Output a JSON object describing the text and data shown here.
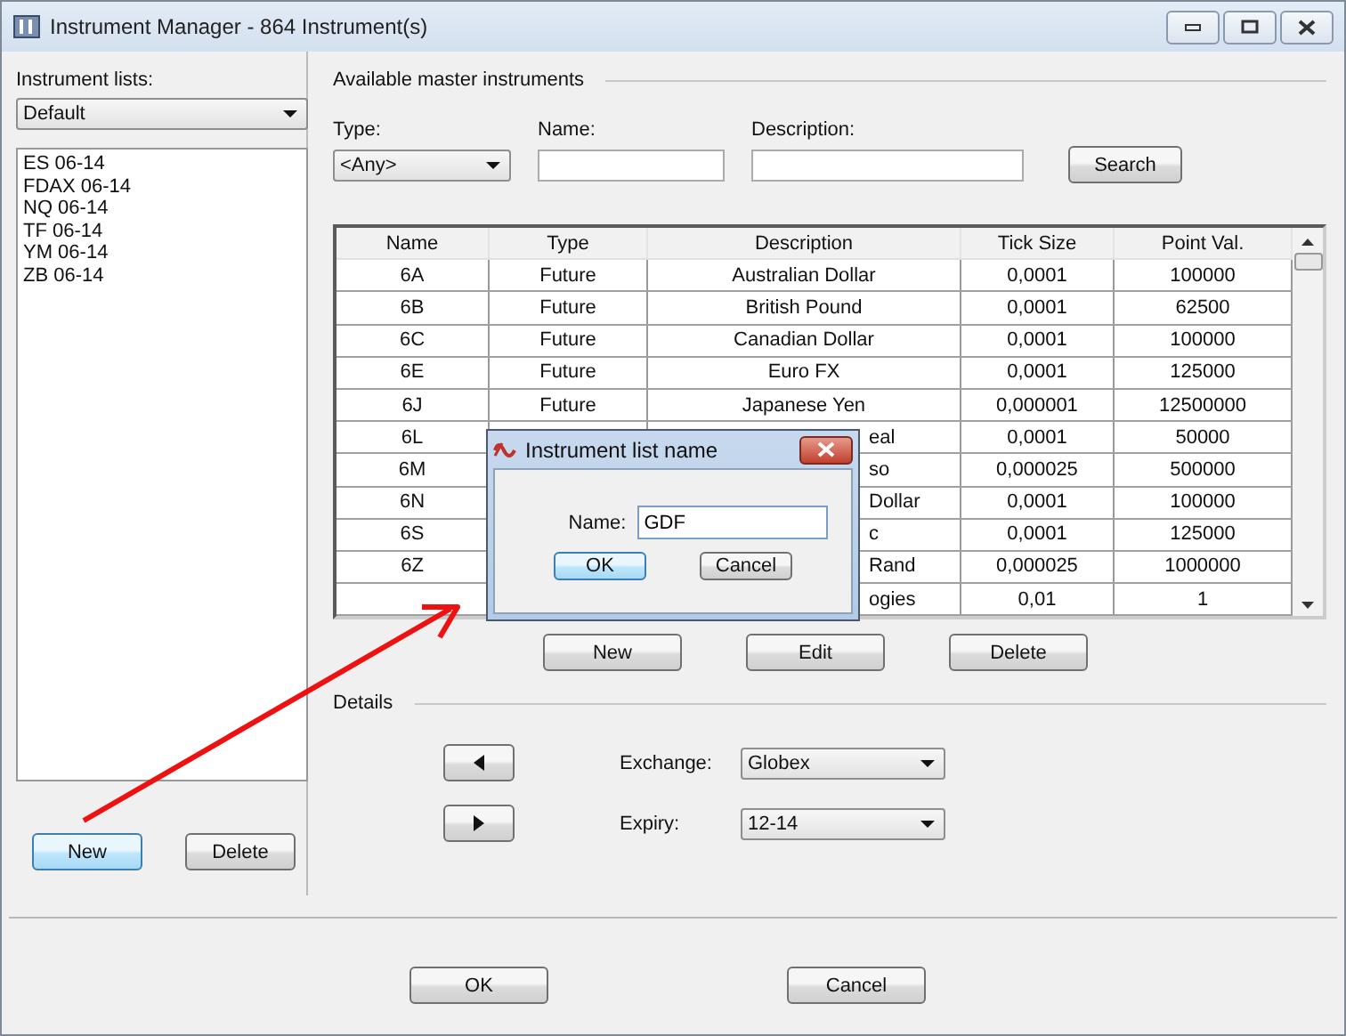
{
  "window": {
    "title": "Instrument Manager - 864 Instrument(s)"
  },
  "instrument_lists": {
    "label": "Instrument lists:",
    "dropdown": "Default",
    "items": [
      "ES 06-14",
      "FDAX 06-14",
      "NQ 06-14",
      "TF 06-14",
      "YM 06-14",
      "ZB 06-14"
    ],
    "buttons": [
      {
        "label": "New",
        "focused": true
      },
      {
        "label": "Delete",
        "focused": false
      }
    ]
  },
  "master": {
    "title": "Available master instruments",
    "type_label": "Type:",
    "type_value": "<Any>",
    "name_label": "Name:",
    "description_label": "Description:",
    "search_button": "Search"
  },
  "table": {
    "columns": [
      "Name",
      "Type",
      "Description",
      "Tick Size",
      "Point Val."
    ],
    "rows": [
      {
        "name": "6A",
        "type": "Future",
        "description": "Australian Dollar",
        "tick_size": "0,0001",
        "point_value": "100000",
        "covered": false
      },
      {
        "name": "6B",
        "type": "Future",
        "description": "British Pound",
        "tick_size": "0,0001",
        "point_value": "62500",
        "covered": false
      },
      {
        "name": "6C",
        "type": "Future",
        "description": "Canadian Dollar",
        "tick_size": "0,0001",
        "point_value": "100000",
        "covered": false
      },
      {
        "name": "6E",
        "type": "Future",
        "description": "Euro FX",
        "tick_size": "0,0001",
        "point_value": "125000",
        "covered": false
      },
      {
        "name": "6J",
        "type": "Future",
        "description": "Japanese Yen",
        "tick_size": "0,000001",
        "point_value": "12500000",
        "covered": false
      },
      {
        "name": "6L",
        "description": "eal",
        "tick_size": "0,0001",
        "point_value": "50000",
        "covered": true
      },
      {
        "name": "6M",
        "description": "so",
        "tick_size": "0,000025",
        "point_value": "500000",
        "covered": true
      },
      {
        "name": "6N",
        "description": "Dollar",
        "tick_size": "0,0001",
        "point_value": "100000",
        "covered": true
      },
      {
        "name": "6S",
        "description": "c",
        "tick_size": "0,0001",
        "point_value": "125000",
        "covered": true
      },
      {
        "name": "6Z",
        "description": "Rand",
        "tick_size": "0,000025",
        "point_value": "1000000",
        "covered": true
      },
      {
        "description": "ogies",
        "tick_size": "0,01",
        "point_value": "1",
        "covered": true
      }
    ],
    "buttons": [
      "New",
      "Edit",
      "Delete"
    ]
  },
  "details": {
    "title": "Details",
    "exchange_label": "Exchange:",
    "exchange_value": "Globex",
    "expiry_label": "Expiry:",
    "expiry_value": "12-14"
  },
  "footer_buttons": [
    "OK",
    "Cancel"
  ],
  "dialog": {
    "title": "Instrument list name",
    "name_label": "Name:",
    "name_value": "GDF",
    "buttons": [
      {
        "label": "OK",
        "focused": true
      },
      {
        "label": "Cancel",
        "focused": false
      }
    ]
  }
}
